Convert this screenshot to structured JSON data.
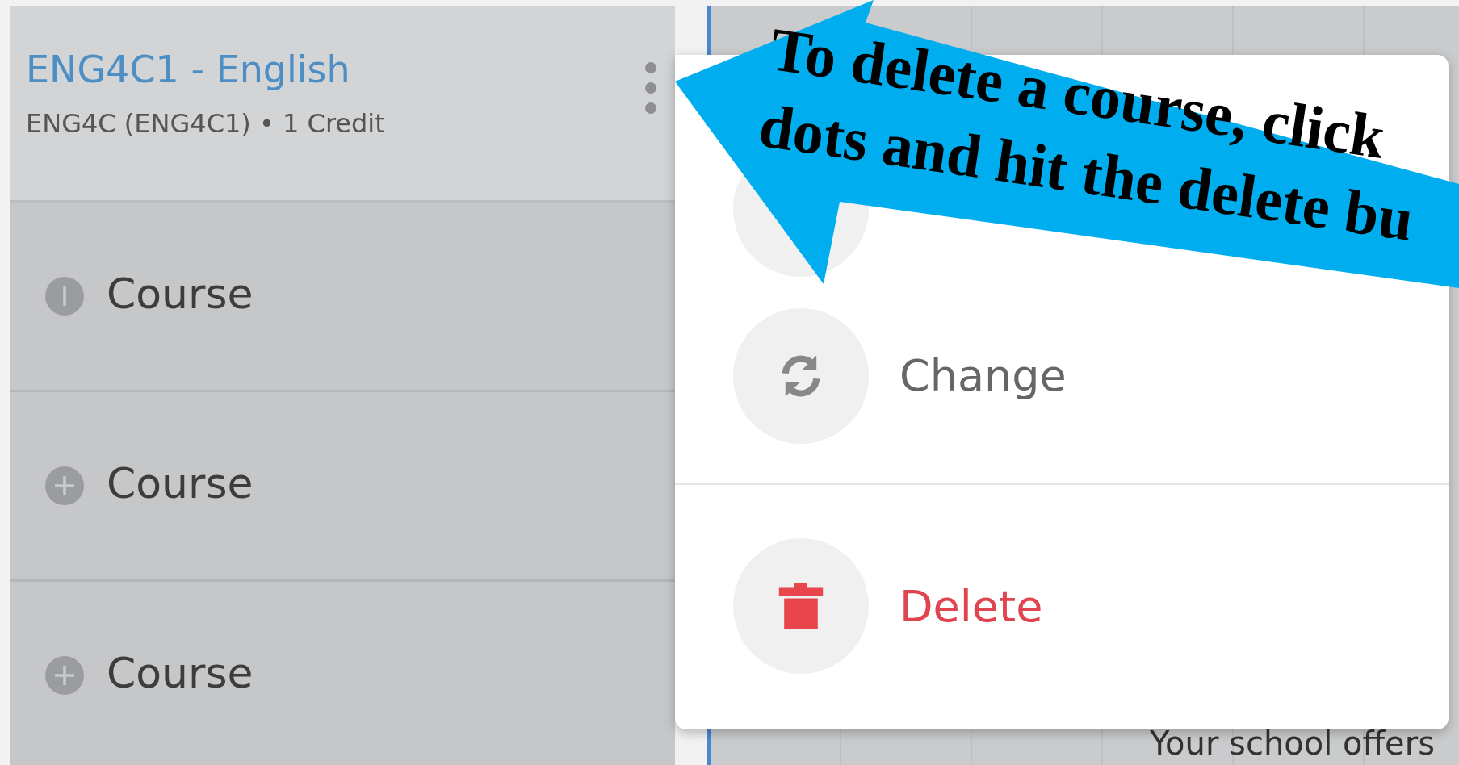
{
  "course_card": {
    "title": "ENG4C1 - English",
    "subtitle": "ENG4C (ENG4C1) • 1 Credit"
  },
  "course_slots": [
    {
      "label": "Course",
      "kind": "filled"
    },
    {
      "label": "Course",
      "kind": "add"
    },
    {
      "label": "Course",
      "kind": "add"
    }
  ],
  "menu": {
    "items": [
      {
        "kind": "hidden"
      },
      {
        "kind": "change",
        "label": "Change"
      },
      {
        "kind": "delete",
        "label": "Delete"
      }
    ]
  },
  "background_text": "Your school offers",
  "callout": {
    "lines": [
      "To delete a course, click",
      "dots and hit the delete bu"
    ]
  }
}
